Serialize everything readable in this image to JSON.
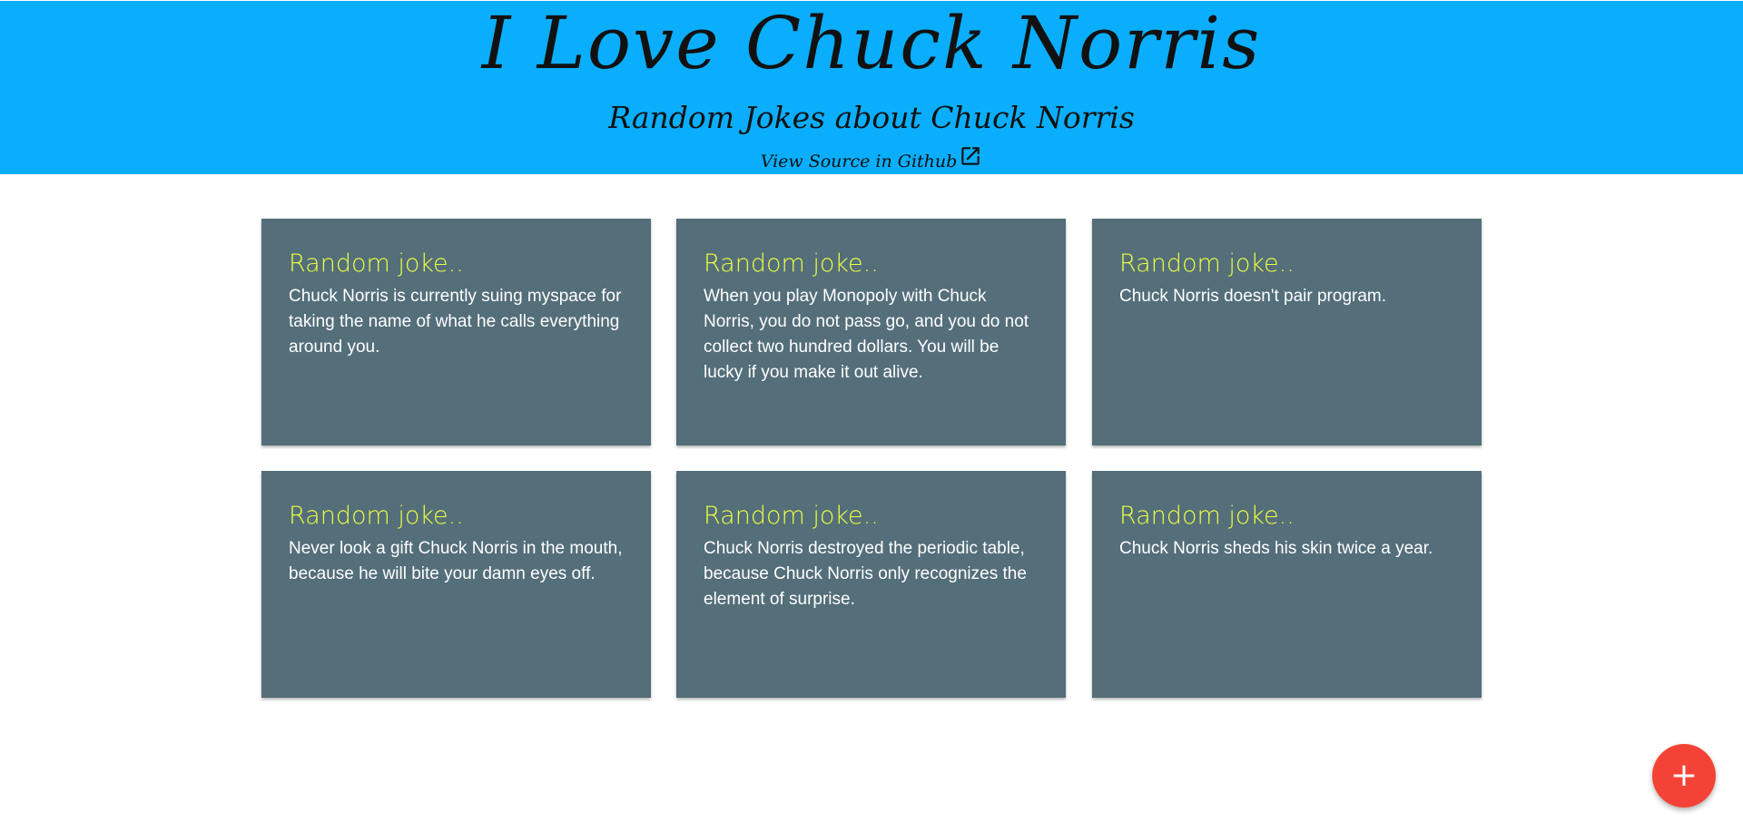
{
  "header": {
    "title": "I Love Chuck Norris",
    "subtitle": "Random Jokes about Chuck Norris",
    "source_link": "View Source in Github",
    "source_icon": "external-link-icon",
    "background_color": "#0aaefc"
  },
  "cards": [
    {
      "title": "Random joke..",
      "text": "Chuck Norris is currently suing myspace for taking the name of what he calls everything around you."
    },
    {
      "title": "Random joke..",
      "text": "When you play Monopoly with Chuck Norris, you do not pass go, and you do not collect two hundred dollars. You will be lucky if you make it out alive."
    },
    {
      "title": "Random joke..",
      "text": "Chuck Norris doesn't pair program."
    },
    {
      "title": "Random joke..",
      "text": "Never look a gift Chuck Norris in the mouth, because he will bite your damn eyes off."
    },
    {
      "title": "Random joke..",
      "text": "Chuck Norris destroyed the periodic table, because Chuck Norris only recognizes the element of surprise."
    },
    {
      "title": "Random joke..",
      "text": "Chuck Norris sheds his skin twice a year."
    }
  ],
  "card_style": {
    "background_color": "#546e7a",
    "title_color": "#eeff41",
    "text_color": "#ffffff"
  },
  "fab": {
    "label": "+",
    "icon": "plus-icon",
    "color": "#f44336"
  }
}
